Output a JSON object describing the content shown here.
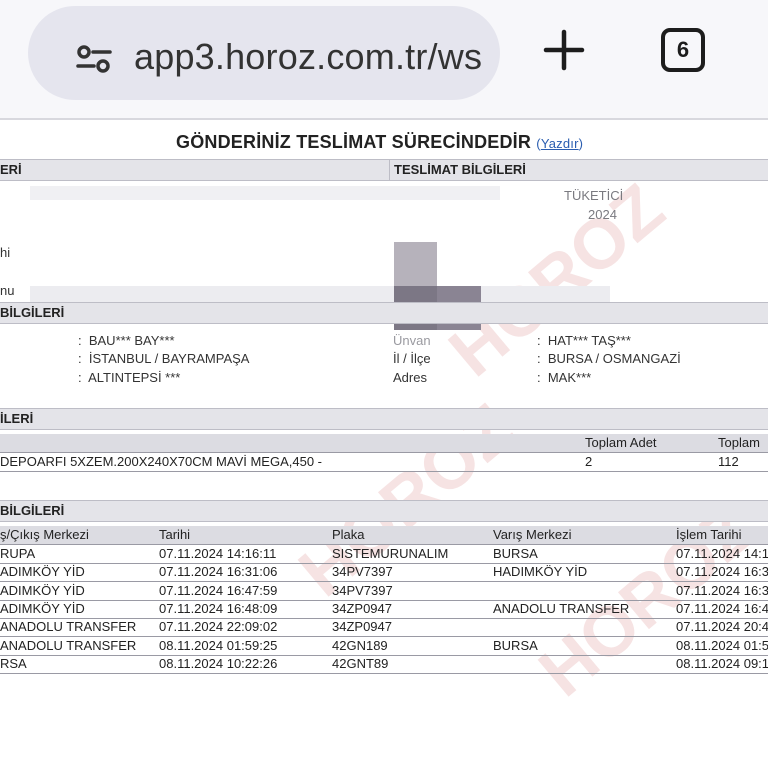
{
  "browser": {
    "url": "app3.horoz.com.tr/ws",
    "tab_count": "6",
    "icons": {
      "site_info": "tune-icon",
      "new_tab": "plus-icon",
      "tabs": "tab-switcher-icon"
    }
  },
  "page": {
    "title": "GÖNDERİNİZ TESLİMAT SÜRECİNDEDİR",
    "print_link": "Yazdır",
    "watermark": "HOROZ",
    "sections": {
      "sender_info": "ERİ",
      "delivery_info": "TESLİMAT BİLGİLERİ",
      "party_info": "BİLGİLERİ",
      "product_info": "İLERİ",
      "movement_info": "BİLGİLERİ"
    },
    "delivery": {
      "type_partial": "TÜKETİCİ",
      "date_partial": "2024"
    },
    "left_labels": [
      "hi",
      "nu"
    ],
    "sender": {
      "name": "BAU*** BAY***",
      "city": "İSTANBUL / BAYRAMPAŞA",
      "address": "ALTINTEPSİ ***"
    },
    "receiver": {
      "labels": [
        "Ünvan",
        "İl / İlçe",
        "Adres"
      ],
      "name": "HAT*** TAŞ***",
      "city": "BURSA / OSMANGAZİ",
      "address": "MAK***"
    },
    "products": {
      "headers": [
        "Toplam Adet",
        "Toplam"
      ],
      "rows": [
        {
          "description": "DEPOARFI 5XZEM.200X240X70CM MAVİ MEGA,450 -",
          "quantity": "2",
          "total": "112"
        }
      ]
    },
    "movements": {
      "headers": [
        "ş/Çıkış Merkezi",
        "Tarihi",
        "Plaka",
        "Varış Merkezi",
        "İşlem Tarihi"
      ],
      "rows": [
        [
          "RUPA",
          "07.11.2024 14:16:11",
          "SISTEMURUNALIM",
          "BURSA",
          "07.11.2024 14:1"
        ],
        [
          "ADIMKÖY YİD",
          "07.11.2024 16:31:06",
          "34PV7397",
          "HADIMKÖY YİD",
          "07.11.2024 16:3"
        ],
        [
          "ADIMKÖY YİD",
          "07.11.2024 16:47:59",
          "34PV7397",
          "",
          "07.11.2024 16:3"
        ],
        [
          "ADIMKÖY YİD",
          "07.11.2024 16:48:09",
          "34ZP0947",
          "ANADOLU TRANSFER",
          "07.11.2024 16:4"
        ],
        [
          "ANADOLU TRANSFER",
          "07.11.2024 22:09:02",
          "34ZP0947",
          "",
          "07.11.2024 20:4"
        ],
        [
          "ANADOLU TRANSFER",
          "08.11.2024 01:59:25",
          "42GN189",
          "BURSA",
          "08.11.2024 01:5"
        ],
        [
          "RSA",
          "08.11.2024 10:22:26",
          "42GNT89",
          "",
          "08.11.2024 09:1"
        ]
      ]
    }
  },
  "colors": {
    "link": "#2a5db0",
    "section_bg": "#e4e4e9",
    "header_bg": "#dcdce2"
  }
}
